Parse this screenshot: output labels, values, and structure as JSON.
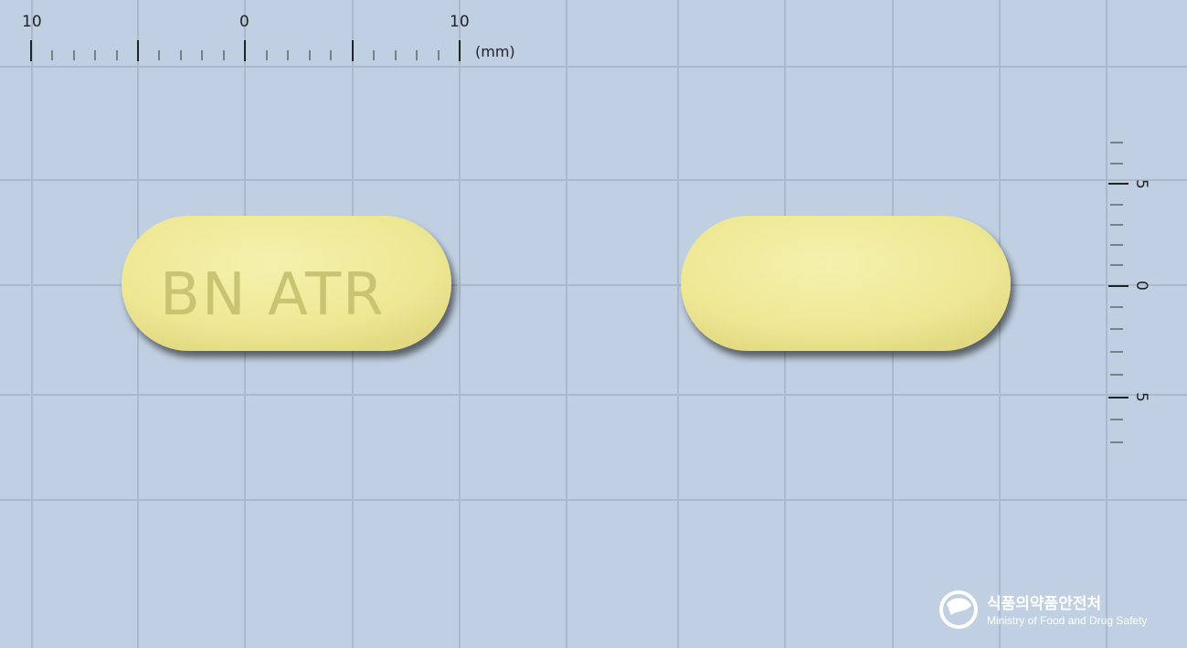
{
  "image": {
    "background_color": "#c0d0e2",
    "grid_color": "#a9b9cc"
  },
  "top_ruler": {
    "labels": [
      "10",
      "0",
      "10"
    ],
    "unit": "(mm)"
  },
  "side_ruler": {
    "labels": [
      "5",
      "0",
      "5"
    ]
  },
  "tablet": {
    "color": "#f1ec9a",
    "front_imprint": "BN ATR",
    "back_imprint": ""
  },
  "watermark": {
    "korean": "식품의약품안전처",
    "english": "Ministry of Food and Drug Safety"
  }
}
